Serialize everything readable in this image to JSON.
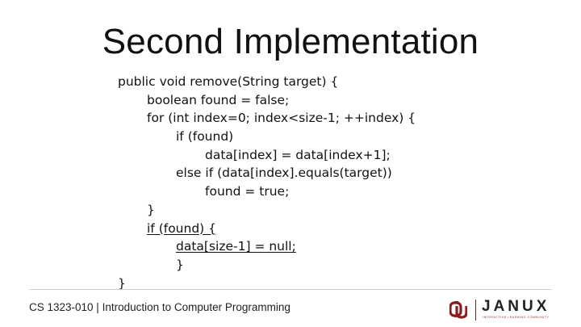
{
  "slide": {
    "title": "Second Implementation",
    "code_lines": [
      "public void remove(String target) {",
      "boolean found = false;",
      "for (int index=0; index<size-1; ++index) {",
      "if (found)",
      "data[index] = data[index+1];",
      "else if (data[index].equals(target))",
      "found = true;",
      "}",
      "if (found) {",
      "data[size-1] = null;",
      "}",
      "}"
    ]
  },
  "footer": {
    "course": "CS 1323-010 | Introduction to Computer Programming"
  },
  "logo": {
    "name": "JANUX",
    "tagline": "INTERACTIVE LEARNING COMMUNITY",
    "accent_color": "#8c1d1d"
  }
}
